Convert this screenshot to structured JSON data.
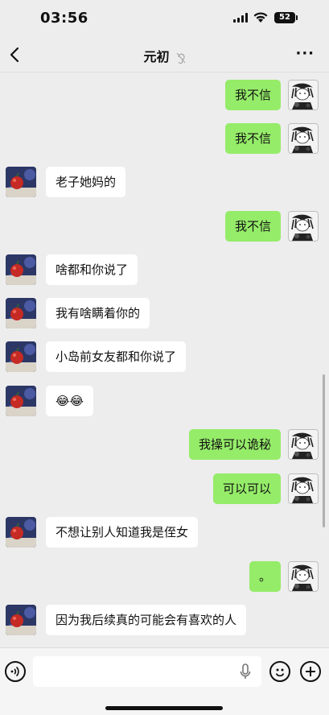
{
  "status_bar": {
    "time": "03:56",
    "battery": "52"
  },
  "nav": {
    "title": "元初",
    "back_icon": "chevron-left-icon",
    "mute_icon": "ear-muted-icon",
    "more_label": "···"
  },
  "messages": [
    {
      "side": "right",
      "text": "我不信"
    },
    {
      "side": "right",
      "text": "我不信"
    },
    {
      "side": "left",
      "text": "老子她妈的"
    },
    {
      "side": "right",
      "text": "我不信"
    },
    {
      "side": "left",
      "text": "啥都和你说了"
    },
    {
      "side": "left",
      "text": "我有啥瞒着你的"
    },
    {
      "side": "left",
      "text": "小岛前女友都和你说了"
    },
    {
      "side": "left",
      "text": "😂😂"
    },
    {
      "side": "right",
      "text": "我操可以诡秘"
    },
    {
      "side": "right",
      "text": "可以可以"
    },
    {
      "side": "left",
      "text": "不想让别人知道我是侄女"
    },
    {
      "side": "right",
      "text": "。"
    },
    {
      "side": "left",
      "text": "因为我后续真的可能会有喜欢的人"
    }
  ],
  "input_bar": {
    "placeholder": "",
    "voice_icon": "voice-icon",
    "mic_icon": "mic-icon",
    "emoji_icon": "emoji-icon",
    "plus_icon": "plus-icon"
  },
  "colors": {
    "background": "#ededed",
    "bubble_right": "#95ec69",
    "bubble_left": "#ffffff"
  }
}
